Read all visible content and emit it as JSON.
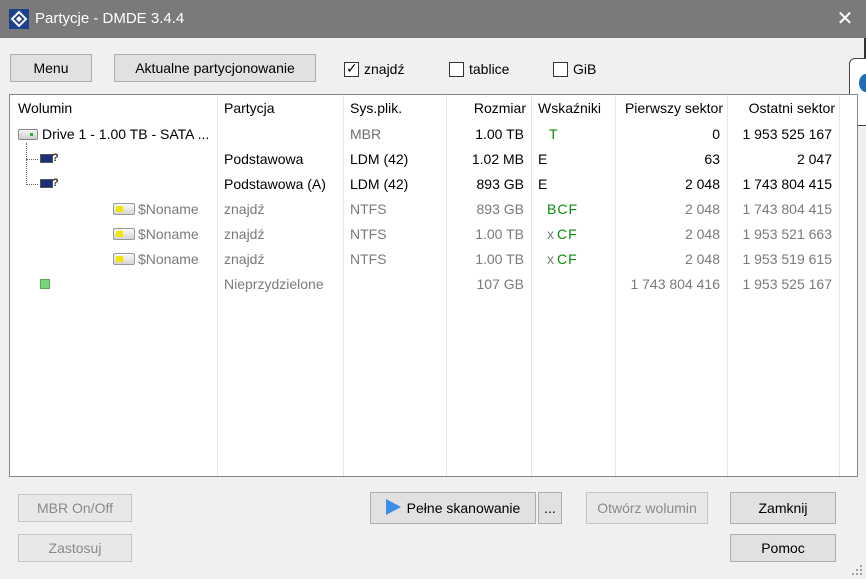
{
  "window": {
    "title": "Partycje - DMDE 3.4.4",
    "close": "✕"
  },
  "toolbar": {
    "menu": "Menu",
    "current_partitioning": "Aktualne partycjonowanie",
    "find": {
      "label": "znajdź",
      "checked": true
    },
    "tables": {
      "label": "tablice",
      "checked": false
    },
    "gib": {
      "label": "GiB",
      "checked": false
    }
  },
  "table": {
    "headers": [
      "Wolumin",
      "Partycja",
      "Sys.plik.",
      "Rozmiar",
      "Wskaźniki",
      "Pierwszy sektor",
      "Ostatni sektor"
    ],
    "rows": [
      {
        "volume": "Drive 1 - 1.00 TB - SATA ...",
        "partition": "",
        "fs": "MBR",
        "size": "1.00 TB",
        "flags": "T",
        "first": "0",
        "last": "1 953 525 167"
      },
      {
        "volume": "",
        "partition": "Podstawowa",
        "fs": "LDM (42)",
        "size": "1.02 MB",
        "flags": "E",
        "first": "63",
        "last": "2 047"
      },
      {
        "volume": "",
        "partition": "Podstawowa (A)",
        "fs": "LDM (42)",
        "size": "893 GB",
        "flags": "E",
        "first": "2 048",
        "last": "1 743 804 415"
      },
      {
        "volume": "$Noname",
        "partition": "znajdź",
        "fs": "NTFS",
        "size": "893 GB",
        "flags": "BCF",
        "first": "2 048",
        "last": "1 743 804 415"
      },
      {
        "volume": "$Noname",
        "partition": "znajdź",
        "fs": "NTFS",
        "size": "1.00 TB",
        "flags_x": "x",
        "flags": "CF",
        "first": "2 048",
        "last": "1 953 521 663"
      },
      {
        "volume": "$Noname",
        "partition": "znajdź",
        "fs": "NTFS",
        "size": "1.00 TB",
        "flags_x": "x",
        "flags": "CF",
        "first": "2 048",
        "last": "1 953 519 615"
      },
      {
        "volume": "",
        "partition": "Nieprzydzielone",
        "fs": "",
        "size": "107 GB",
        "flags": "",
        "first": "1 743 804 416",
        "last": "1 953 525 167"
      }
    ]
  },
  "buttons": {
    "mbr_toggle": "MBR On/Off",
    "apply": "Zastosuj",
    "full_scan": "Pełne skanowanie",
    "more": "...",
    "open_volume": "Otwórz wolumin",
    "close": "Zamknij",
    "help": "Pomoc"
  },
  "colors": {
    "titlebar": "#7a7a7a",
    "flag_green": "#0a8a0a",
    "play_blue": "#3d8ee6"
  }
}
